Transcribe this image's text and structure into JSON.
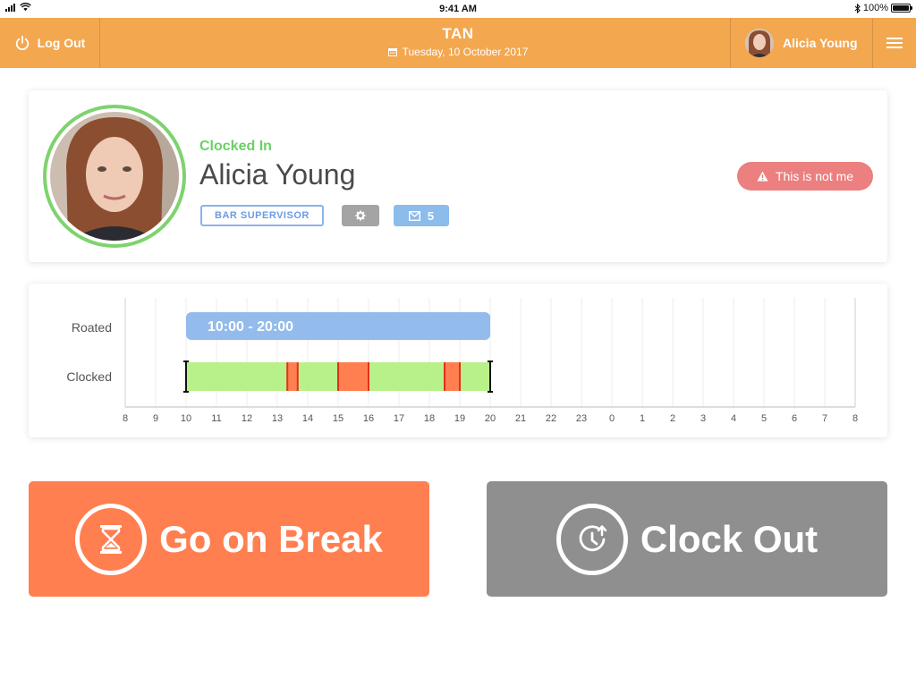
{
  "status_bar": {
    "time": "9:41 AM",
    "battery": "100%"
  },
  "header": {
    "logout_label": "Log Out",
    "title": "TAN",
    "date": "Tuesday, 10 October 2017",
    "user_name": "Alicia Young"
  },
  "profile": {
    "status": "Clocked In",
    "name": "Alicia Young",
    "role": "BAR SUPERVISOR",
    "message_count": "5",
    "not_me_label": "This is not me"
  },
  "timeline": {
    "row_labels": [
      "Roated",
      "Clocked"
    ],
    "hours": [
      "8",
      "9",
      "10",
      "11",
      "12",
      "13",
      "14",
      "15",
      "16",
      "17",
      "18",
      "19",
      "20",
      "21",
      "22",
      "23",
      "0",
      "1",
      "2",
      "3",
      "4",
      "5",
      "6",
      "7",
      "8"
    ],
    "rostered": {
      "label": "10:00 - 20:00",
      "start": 10,
      "end": 20
    },
    "clocked": {
      "start": 10,
      "end": 20
    },
    "breaks": [
      {
        "start": 13.33,
        "end": 13.67
      },
      {
        "start": 15,
        "end": 16
      },
      {
        "start": 18.5,
        "end": 19
      }
    ],
    "colors": {
      "rostered": "#93bbec",
      "clocked": "#b8f08a",
      "break": "#ff7f50",
      "break_border": "#e0301e"
    }
  },
  "actions": {
    "break_label": "Go on Break",
    "clockout_label": "Clock Out"
  },
  "colors": {
    "header": "#f3a74f",
    "clocked_in": "#6ad163",
    "not_me": "#ec7f7f",
    "break_button": "#ff7f50",
    "clockout_button": "#8f8f8f"
  }
}
